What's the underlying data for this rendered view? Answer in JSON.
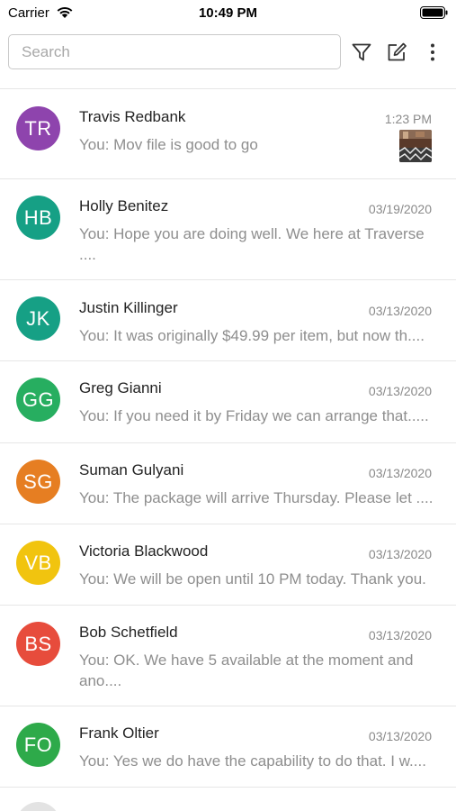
{
  "status_bar": {
    "carrier": "Carrier",
    "time": "10:49 PM"
  },
  "search": {
    "placeholder": "Search",
    "value": ""
  },
  "toolbar_icons": [
    "filter-icon",
    "compose-icon",
    "more-vertical-icon"
  ],
  "conversations": [
    {
      "initials": "TR",
      "name": "Travis Redbank",
      "time": "1:23 PM",
      "preview": "You: Mov file is good to go",
      "color": "#8e44ad",
      "has_thumbnail": true
    },
    {
      "initials": "HB",
      "name": "Holly Benitez",
      "time": "03/19/2020",
      "preview": "You: Hope you are doing well. We here at Traverse",
      "preview_2": "....",
      "color": "#16a085"
    },
    {
      "initials": "JK",
      "name": "Justin Killinger",
      "time": "03/13/2020",
      "preview": "You: It was originally $49.99 per item, but now th....",
      "color": "#16a085"
    },
    {
      "initials": "GG",
      "name": "Greg Gianni",
      "time": "03/13/2020",
      "preview": "You: If you need it by Friday we can arrange that.....",
      "color": "#27ae60"
    },
    {
      "initials": "SG",
      "name": "Suman Gulyani",
      "time": "03/13/2020",
      "preview": "You: The package will arrive Thursday. Please let ....",
      "color": "#e67e22"
    },
    {
      "initials": "VB",
      "name": "Victoria Blackwood",
      "time": "03/13/2020",
      "preview": "You: We will be open until 10 PM today. Thank you.",
      "color": "#f1c40f"
    },
    {
      "initials": "BS",
      "name": "Bob Schetfield",
      "time": "03/13/2020",
      "preview": "You: OK. We have 5 available at the moment and",
      "preview_2": "ano....",
      "color": "#e74c3c"
    },
    {
      "initials": "FO",
      "name": "Frank Oltier",
      "time": "03/13/2020",
      "preview": "You: Yes we do have the capability to do that. I w....",
      "color": "#2eaa4a"
    }
  ]
}
